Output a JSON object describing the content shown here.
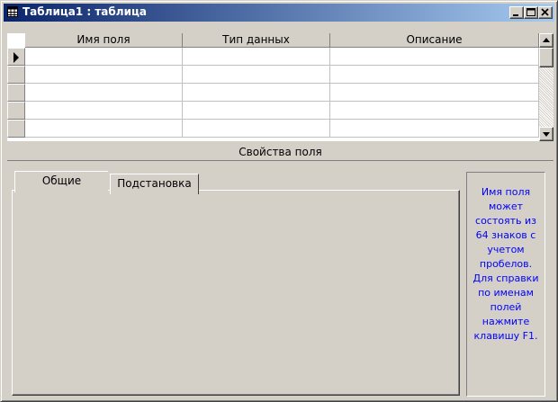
{
  "window": {
    "title": "Таблица1 : таблица",
    "icon": "table-icon",
    "buttons": [
      "minimize-icon",
      "maximize-icon",
      "close-icon"
    ]
  },
  "grid": {
    "columns": [
      "Имя поля",
      "Тип данных",
      "Описание"
    ],
    "current_row_marker": "row-pointer-icon",
    "rows": [
      [
        "",
        "",
        ""
      ],
      [
        "",
        "",
        ""
      ],
      [
        "",
        "",
        ""
      ],
      [
        "",
        "",
        ""
      ],
      [
        "",
        "",
        ""
      ]
    ]
  },
  "properties": {
    "header": "Свойства поля",
    "tabs": [
      "Общие",
      "Подстановка"
    ],
    "active_tab": "Общие"
  },
  "help_text": "Имя поля может состоять из 64 знаков с учетом пробелов. Для справки по именам полей нажмите клавишу F1.",
  "colors": {
    "title_gradient_start": "#0a246a",
    "title_gradient_end": "#a6caf0",
    "help_text": "#0000ff",
    "face": "#d4d0c8"
  }
}
